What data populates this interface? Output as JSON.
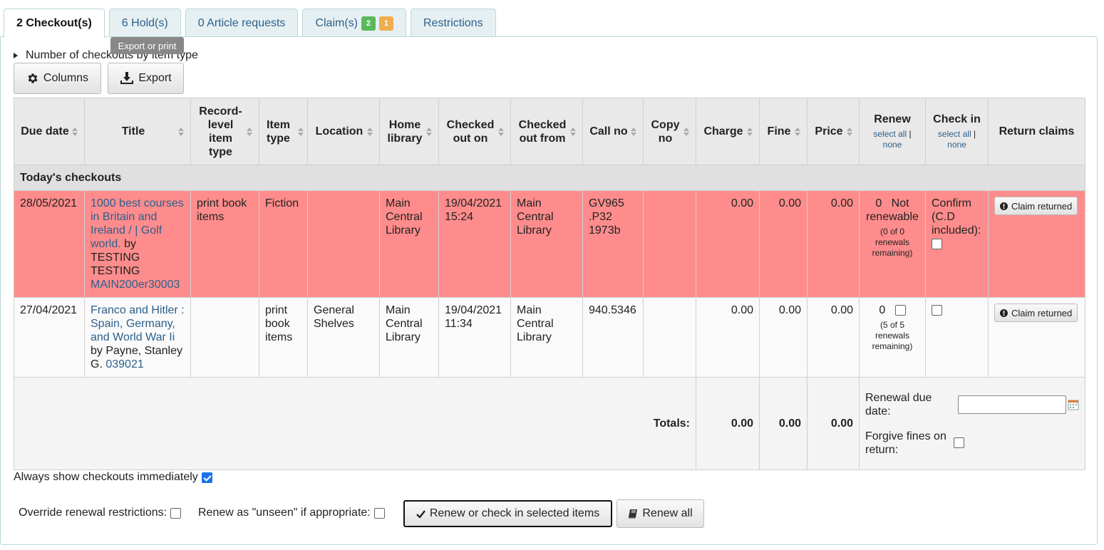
{
  "tabs": [
    {
      "label": "2 Checkout(s)"
    },
    {
      "label": "6 Hold(s)"
    },
    {
      "label": "0 Article requests"
    },
    {
      "label": "Claim(s)",
      "badge_green": "2",
      "badge_orange": "1"
    },
    {
      "label": "Restrictions"
    }
  ],
  "tooltip": "Export or print",
  "toggle_label": "Number of checkouts by item type",
  "toolbar": {
    "columns_label": "Columns",
    "export_label": "Export"
  },
  "headers": {
    "due_date": "Due date",
    "title": "Title",
    "record_level_item_type": "Record-level item type",
    "item_type": "Item type",
    "location": "Location",
    "home_library": "Home library",
    "checked_out_on": "Checked out on",
    "checked_out_from": "Checked out from",
    "call_no": "Call no",
    "copy_no": "Copy no",
    "charge": "Charge",
    "fine": "Fine",
    "price": "Price",
    "renew": "Renew",
    "check_in": "Check in",
    "return_claims": "Return claims",
    "select_all": "select all",
    "pipe": "|",
    "none": "none"
  },
  "group_label": "Today's checkouts",
  "rows": [
    {
      "due": "28/05/2021",
      "title_link": "1000 best courses in Britain and Ireland / | Golf world.",
      "by_text": "by TESTING TESTING",
      "barcode": "MAIN200er30003",
      "record_level_item_type": "print book items",
      "item_type": "Fiction",
      "location": "",
      "home_library": "Main Central Library",
      "checked_out_on": "19/04/2021 15:24",
      "checked_out_from": "Main Central Library",
      "call_no": "GV965 .P32 1973b",
      "copy_no": "",
      "charge": "0.00",
      "fine": "0.00",
      "price": "0.00",
      "renew_count": "0",
      "renew_status": "Not renewable",
      "renew_remaining": "(0 of 0 renewals remaining)",
      "checkin_text": "Confirm (C.D included):",
      "claim_label": "Claim returned"
    },
    {
      "due": "27/04/2021",
      "title_link": "Franco and Hitler : Spain, Germany, and World War Ii",
      "by_text": "by Payne, Stanley G.",
      "barcode": "039021",
      "record_level_item_type": "",
      "item_type": "print book items",
      "location": "General Shelves",
      "home_library": "Main Central Library",
      "checked_out_on": "19/04/2021 11:34",
      "checked_out_from": "Main Central Library",
      "call_no": "940.5346",
      "copy_no": "",
      "charge": "0.00",
      "fine": "0.00",
      "price": "0.00",
      "renew_count": "0",
      "renew_status": "",
      "renew_remaining": "(5 of 5 renewals remaining)",
      "checkin_text": "",
      "claim_label": "Claim returned"
    }
  ],
  "totals": {
    "label": "Totals:",
    "charge": "0.00",
    "fine": "0.00",
    "price": "0.00",
    "renewal_due_date_label": "Renewal due date:",
    "renewal_due_date_value": "",
    "forgive_fines_label": "Forgive fines on return:"
  },
  "always_show_label": "Always show checkouts immediately",
  "override_label": "Override renewal restrictions:",
  "renew_unseen_label": "Renew as \"unseen\" if appropriate:",
  "renew_checkin_button": "Renew or check in selected items",
  "renew_all_button": "Renew all",
  "colors": {
    "overdue_row": "#ff8c8c",
    "link": "#2c5f8c",
    "tab_bg": "#e6f0f2"
  }
}
